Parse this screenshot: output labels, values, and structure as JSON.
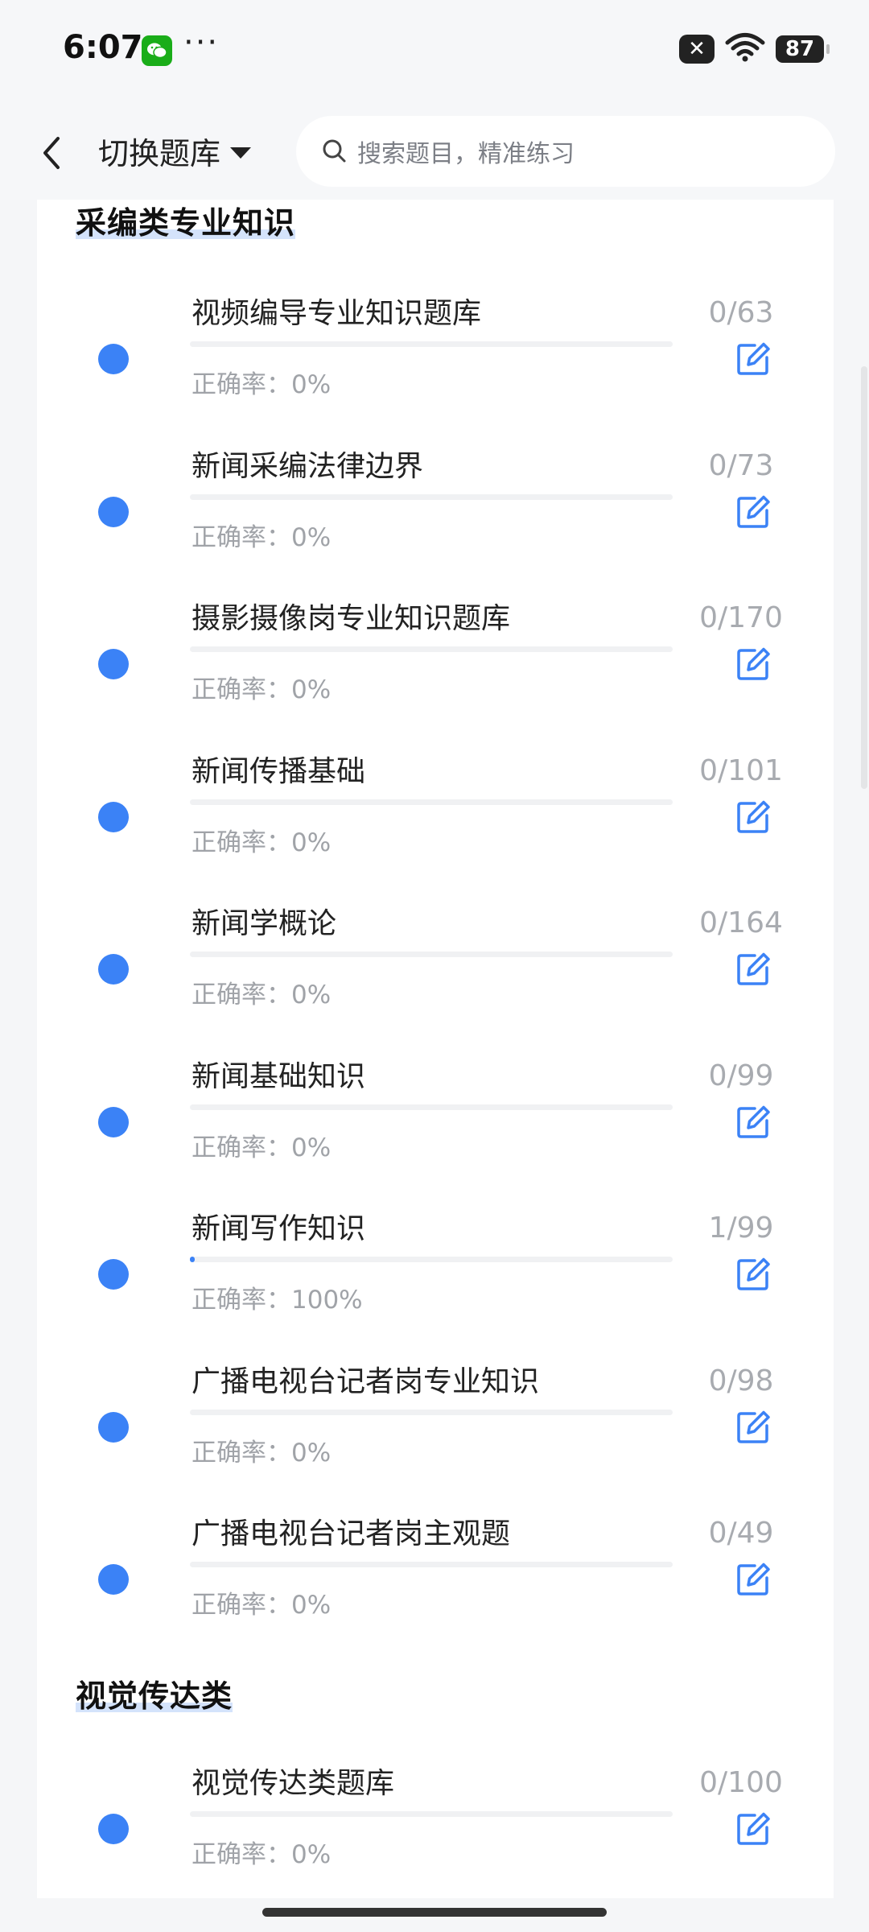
{
  "status_bar": {
    "time": "6:07",
    "more": "···",
    "x_badge": "✕",
    "battery": "87",
    "icons": [
      "wechat-icon",
      "wifi-icon"
    ]
  },
  "header": {
    "switch_label": "切换题库",
    "search_placeholder": "搜索题目，精准练习"
  },
  "sections": [
    {
      "title": "采编类专业知识",
      "items": [
        {
          "name": "视频编导专业知识题库",
          "accuracy": "正确率：0%",
          "count": "0/63",
          "progress": 0
        },
        {
          "name": "新闻采编法律边界",
          "accuracy": "正确率：0%",
          "count": "0/73",
          "progress": 0
        },
        {
          "name": "摄影摄像岗专业知识题库",
          "accuracy": "正确率：0%",
          "count": "0/170",
          "progress": 0
        },
        {
          "name": "新闻传播基础",
          "accuracy": "正确率：0%",
          "count": "0/101",
          "progress": 0
        },
        {
          "name": "新闻学概论",
          "accuracy": "正确率：0%",
          "count": "0/164",
          "progress": 0
        },
        {
          "name": "新闻基础知识",
          "accuracy": "正确率：0%",
          "count": "0/99",
          "progress": 0
        },
        {
          "name": "新闻写作知识",
          "accuracy": "正确率：100%",
          "count": "1/99",
          "progress": 0.0101
        },
        {
          "name": "广播电视台记者岗专业知识",
          "accuracy": "正确率：0%",
          "count": "0/98",
          "progress": 0
        },
        {
          "name": "广播电视台记者岗主观题",
          "accuracy": "正确率：0%",
          "count": "0/49",
          "progress": 0
        }
      ]
    },
    {
      "title": "视觉传达类",
      "items": [
        {
          "name": "视觉传达类题库",
          "accuracy": "正确率：0%",
          "count": "0/100",
          "progress": 0
        }
      ]
    }
  ],
  "colors": {
    "accent": "#3b82f6",
    "highlight": "#d4e3fb",
    "muted_text": "#a0a3a8"
  }
}
